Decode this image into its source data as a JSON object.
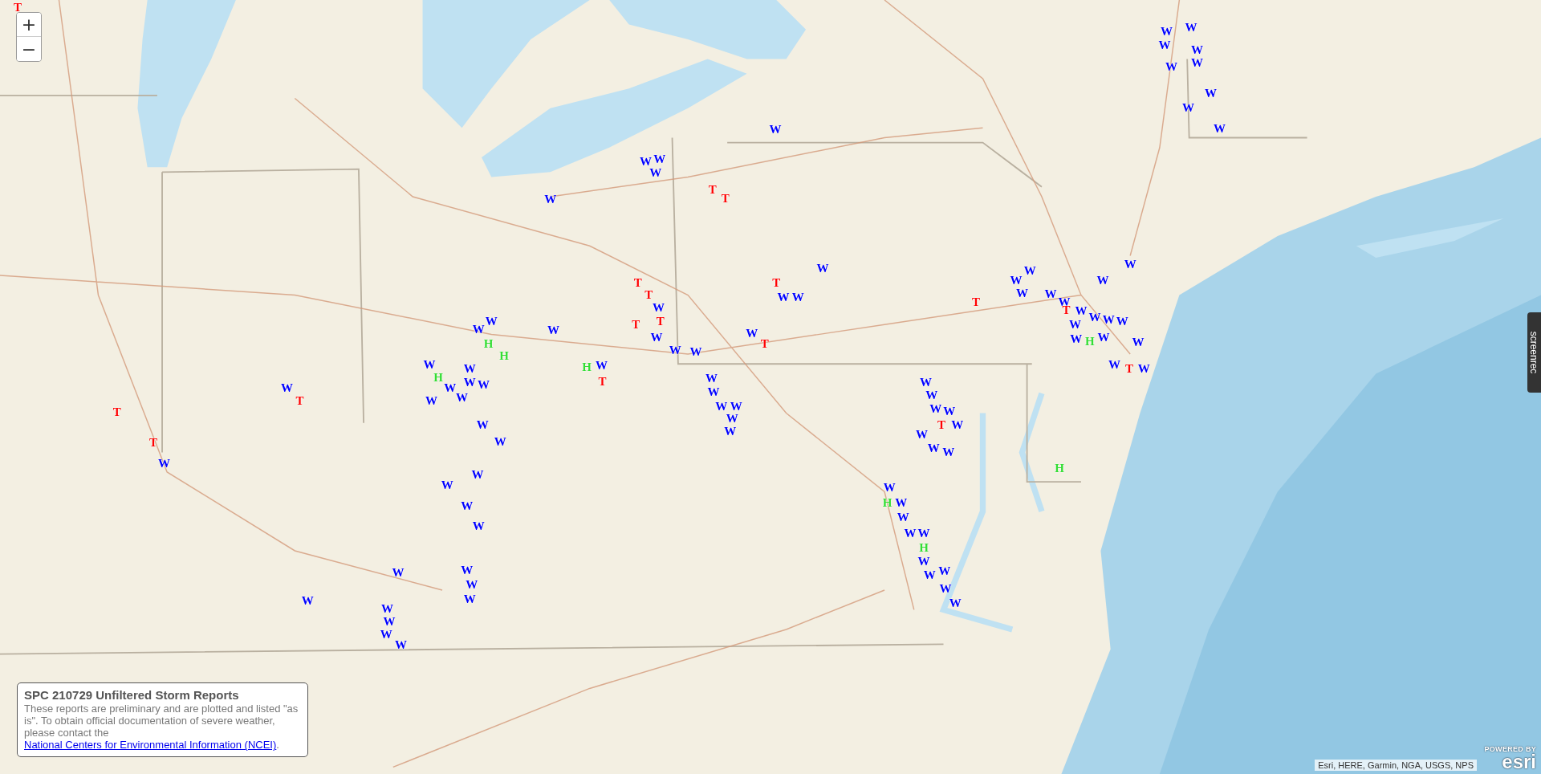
{
  "zoom_controls": [
    {
      "label": "+",
      "kind": "in"
    },
    {
      "label": "−",
      "kind": "out"
    }
  ],
  "legend": {
    "title": "SPC 210729 Unfiltered Storm Reports",
    "text_before": "These reports are preliminary and are plotted and listed \"as is\". To obtain official documentation of severe weather, please contact the ",
    "link": "National Centers for Environmental Information (NCEI)",
    "text_after": "."
  },
  "side_tab": {
    "text": "screenrec"
  },
  "attribution": "Esri, HERE, Garmin, NGA, USGS, NPS",
  "logo": {
    "caption": "POWERED BY",
    "name": "esri"
  },
  "reports": [
    {
      "label": "T",
      "kind": "tornado"
    },
    {
      "label": "W",
      "kind": "wind"
    },
    {
      "label": "W",
      "kind": "wind"
    },
    {
      "label": "W",
      "kind": "wind"
    },
    {
      "label": "W",
      "kind": "wind"
    },
    {
      "label": "W",
      "kind": "wind"
    },
    {
      "label": "W",
      "kind": "wind"
    },
    {
      "label": "W",
      "kind": "wind"
    },
    {
      "label": "W",
      "kind": "wind"
    },
    {
      "label": "W",
      "kind": "wind"
    },
    {
      "label": "W",
      "kind": "wind"
    },
    {
      "label": "W",
      "kind": "wind"
    },
    {
      "label": "W",
      "kind": "wind"
    },
    {
      "label": "W",
      "kind": "wind"
    },
    {
      "label": "W",
      "kind": "wind"
    },
    {
      "label": "T",
      "kind": "tornado"
    },
    {
      "label": "T",
      "kind": "tornado"
    },
    {
      "label": "W",
      "kind": "wind"
    },
    {
      "label": "T",
      "kind": "tornado"
    },
    {
      "label": "W",
      "kind": "wind"
    },
    {
      "label": "W",
      "kind": "wind"
    },
    {
      "label": "T",
      "kind": "tornado"
    },
    {
      "label": "T",
      "kind": "tornado"
    },
    {
      "label": "W",
      "kind": "wind"
    },
    {
      "label": "T",
      "kind": "tornado"
    },
    {
      "label": "T",
      "kind": "tornado"
    },
    {
      "label": "W",
      "kind": "wind"
    },
    {
      "label": "W",
      "kind": "wind"
    },
    {
      "label": "W",
      "kind": "wind"
    },
    {
      "label": "W",
      "kind": "wind"
    },
    {
      "label": "T",
      "kind": "tornado"
    },
    {
      "label": "W",
      "kind": "wind"
    },
    {
      "label": "W",
      "kind": "wind"
    },
    {
      "label": "W",
      "kind": "wind"
    },
    {
      "label": "W",
      "kind": "wind"
    },
    {
      "label": "W",
      "kind": "wind"
    },
    {
      "label": "W",
      "kind": "wind"
    },
    {
      "label": "W",
      "kind": "wind"
    },
    {
      "label": "W",
      "kind": "wind"
    },
    {
      "label": "W",
      "kind": "wind"
    },
    {
      "label": "H",
      "kind": "hail"
    },
    {
      "label": "H",
      "kind": "hail"
    },
    {
      "label": "W",
      "kind": "wind"
    },
    {
      "label": "H",
      "kind": "hail"
    },
    {
      "label": "W",
      "kind": "wind"
    },
    {
      "label": "W",
      "kind": "wind"
    },
    {
      "label": "W",
      "kind": "wind"
    },
    {
      "label": "W",
      "kind": "wind"
    },
    {
      "label": "W",
      "kind": "wind"
    },
    {
      "label": "W",
      "kind": "wind"
    },
    {
      "label": "H",
      "kind": "hail"
    },
    {
      "label": "T",
      "kind": "tornado"
    },
    {
      "label": "W",
      "kind": "wind"
    },
    {
      "label": "W",
      "kind": "wind"
    },
    {
      "label": "T",
      "kind": "tornado"
    },
    {
      "label": "T",
      "kind": "tornado"
    },
    {
      "label": "T",
      "kind": "tornado"
    },
    {
      "label": "W",
      "kind": "wind"
    },
    {
      "label": "W",
      "kind": "wind"
    },
    {
      "label": "W",
      "kind": "wind"
    },
    {
      "label": "W",
      "kind": "wind"
    },
    {
      "label": "W",
      "kind": "wind"
    },
    {
      "label": "W",
      "kind": "wind"
    },
    {
      "label": "W",
      "kind": "wind"
    },
    {
      "label": "W",
      "kind": "wind"
    },
    {
      "label": "W",
      "kind": "wind"
    },
    {
      "label": "W",
      "kind": "wind"
    },
    {
      "label": "W",
      "kind": "wind"
    },
    {
      "label": "W",
      "kind": "wind"
    },
    {
      "label": "W",
      "kind": "wind"
    },
    {
      "label": "W",
      "kind": "wind"
    },
    {
      "label": "W",
      "kind": "wind"
    },
    {
      "label": "W",
      "kind": "wind"
    },
    {
      "label": "T",
      "kind": "tornado"
    },
    {
      "label": "W",
      "kind": "wind"
    },
    {
      "label": "W",
      "kind": "wind"
    },
    {
      "label": "W",
      "kind": "wind"
    },
    {
      "label": "W",
      "kind": "wind"
    },
    {
      "label": "W",
      "kind": "wind"
    },
    {
      "label": "W",
      "kind": "wind"
    },
    {
      "label": "W",
      "kind": "wind"
    },
    {
      "label": "T",
      "kind": "tornado"
    },
    {
      "label": "W",
      "kind": "wind"
    },
    {
      "label": "W",
      "kind": "wind"
    },
    {
      "label": "W",
      "kind": "wind"
    },
    {
      "label": "W",
      "kind": "wind"
    },
    {
      "label": "W",
      "kind": "wind"
    },
    {
      "label": "W",
      "kind": "wind"
    },
    {
      "label": "H",
      "kind": "hail"
    },
    {
      "label": "W",
      "kind": "wind"
    },
    {
      "label": "W",
      "kind": "wind"
    },
    {
      "label": "W",
      "kind": "wind"
    },
    {
      "label": "T",
      "kind": "tornado"
    },
    {
      "label": "W",
      "kind": "wind"
    },
    {
      "label": "W",
      "kind": "wind"
    },
    {
      "label": "W",
      "kind": "wind"
    },
    {
      "label": "W",
      "kind": "wind"
    },
    {
      "label": "W",
      "kind": "wind"
    },
    {
      "label": "T",
      "kind": "tornado"
    },
    {
      "label": "W",
      "kind": "wind"
    },
    {
      "label": "W",
      "kind": "wind"
    },
    {
      "label": "W",
      "kind": "wind"
    },
    {
      "label": "W",
      "kind": "wind"
    },
    {
      "label": "H",
      "kind": "hail"
    },
    {
      "label": "W",
      "kind": "wind"
    },
    {
      "label": "H",
      "kind": "hail"
    },
    {
      "label": "W",
      "kind": "wind"
    },
    {
      "label": "W",
      "kind": "wind"
    },
    {
      "label": "W",
      "kind": "wind"
    },
    {
      "label": "W",
      "kind": "wind"
    },
    {
      "label": "H",
      "kind": "hail"
    },
    {
      "label": "W",
      "kind": "wind"
    },
    {
      "label": "W",
      "kind": "wind"
    },
    {
      "label": "W",
      "kind": "wind"
    },
    {
      "label": "W",
      "kind": "wind"
    },
    {
      "label": "W",
      "kind": "wind"
    }
  ]
}
